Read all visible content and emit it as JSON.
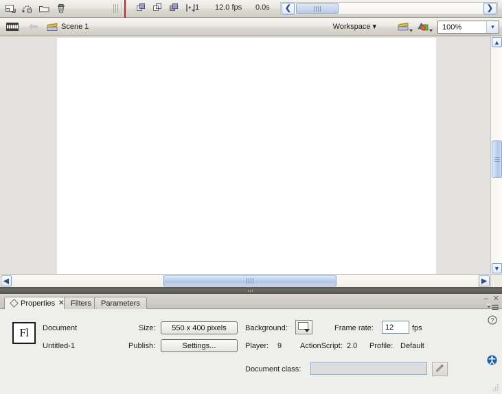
{
  "timeline": {
    "layer_tools": [
      {
        "name": "insert-layer-icon",
        "title": "Insert Layer"
      },
      {
        "name": "add-motion-guide-icon",
        "title": "Add Motion Guide"
      },
      {
        "name": "insert-layer-folder-icon",
        "title": "Insert Layer Folder"
      },
      {
        "name": "delete-layer-icon",
        "title": "Delete Layer"
      }
    ],
    "onion_tools": [
      {
        "name": "onion-skin-icon",
        "title": "Onion Skin"
      },
      {
        "name": "onion-skin-outlines-icon",
        "title": "Onion Skin Outlines"
      },
      {
        "name": "edit-multiple-frames-icon",
        "title": "Edit Multiple Frames"
      },
      {
        "name": "modify-onion-markers-icon",
        "title": "Modify Onion Markers"
      }
    ],
    "current_frame": "1",
    "frame_rate_display": "12.0 fps",
    "elapsed_time": "0.0s",
    "scroll_left_label": "❮",
    "scroll_right_label": "❯"
  },
  "scene_bar": {
    "edit_bar_icon": "timeline-toggle-icon",
    "back_label": "←",
    "scene_name": "Scene 1",
    "workspace_label": "Workspace",
    "workspace_caret": "▾",
    "zoom_value": "100%",
    "zoom_caret": "▾"
  },
  "stage": {
    "background_color": "#ffffff",
    "work_area_color": "#e3e2df"
  },
  "panel": {
    "tabs": [
      {
        "label": "Properties",
        "active": true,
        "closable": true
      },
      {
        "label": "Filters",
        "active": false,
        "closable": false
      },
      {
        "label": "Parameters",
        "active": false,
        "closable": false
      }
    ],
    "close_glyph": "✕",
    "minimize_glyph": "–",
    "window_close_glyph": "✕",
    "icon_text": "Fl",
    "doc_type": "Document",
    "doc_name": "Untitled-1",
    "size_label": "Size:",
    "size_value": "550 x 400 pixels",
    "publish_label": "Publish:",
    "publish_value": "Settings...",
    "background_label": "Background:",
    "background_color": "#ffffff",
    "frame_rate_label": "Frame rate:",
    "frame_rate_value": "12",
    "fps_label": "fps",
    "player_label": "Player:",
    "player_value": "9",
    "actionscript_label": "ActionScript:",
    "actionscript_value": "2.0",
    "profile_label": "Profile:",
    "profile_value": "Default",
    "document_class_label": "Document class:",
    "document_class_value": "",
    "help_glyph": "?"
  },
  "colors": {
    "accent_blue": "#2d4f86",
    "playhead_red": "#cf1f2a",
    "panel_bg": "#eeeeea",
    "chrome_bg": "#d4d0c8",
    "divider": "#5e5e58"
  }
}
